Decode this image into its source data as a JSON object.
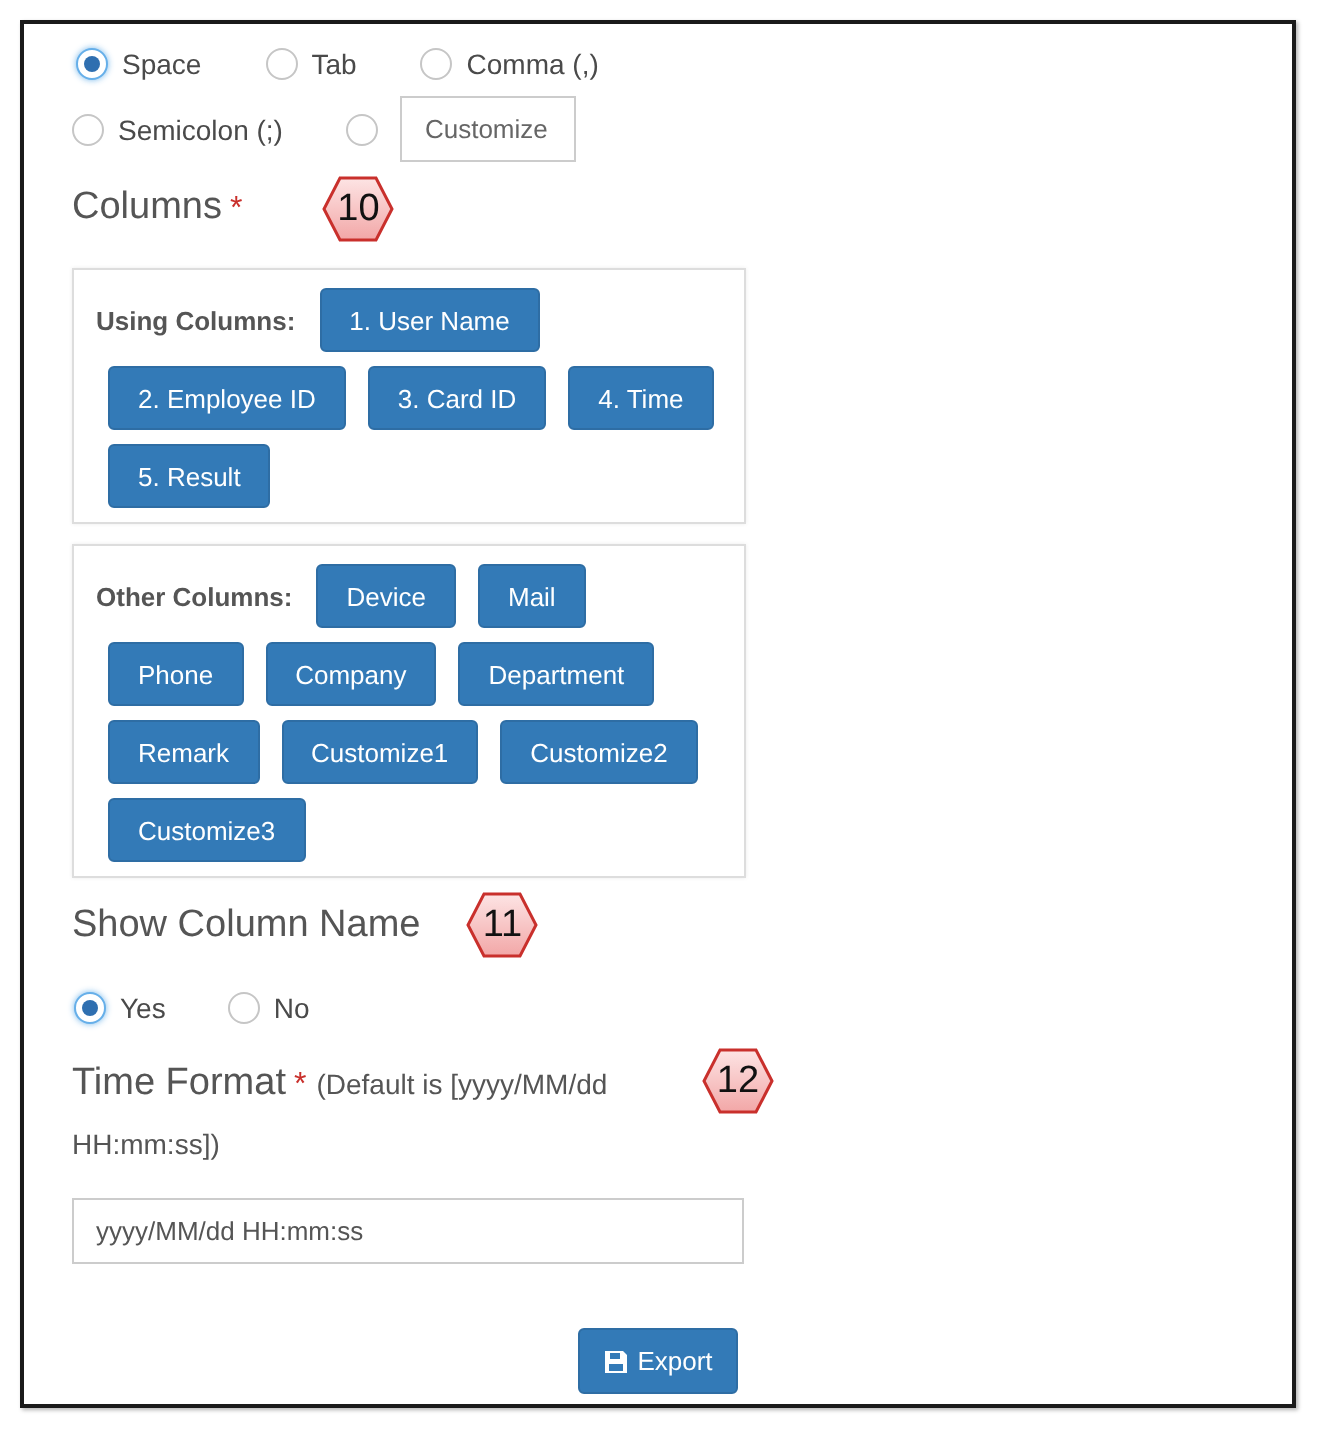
{
  "delimiter": {
    "rows": [
      {
        "options": [
          {
            "kind": "text",
            "label": "Space",
            "selected": true
          },
          {
            "kind": "text",
            "label": "Tab",
            "selected": false
          },
          {
            "kind": "text",
            "label": "Comma (,)",
            "selected": false
          }
        ]
      },
      {
        "options": [
          {
            "kind": "text",
            "label": "Semicolon (;)",
            "selected": false
          },
          {
            "kind": "field",
            "placeholder": "Customize",
            "selected": false
          }
        ]
      }
    ]
  },
  "columns": {
    "heading": "Columns",
    "required_mark": "*",
    "callout": "10",
    "groups": [
      {
        "label": "Using Columns:",
        "items": [
          "1. User Name",
          "2. Employee ID",
          "3. Card ID",
          "4. Time",
          "5. Result"
        ]
      },
      {
        "label": "Other Columns:",
        "items": [
          "Device",
          "Mail",
          "Phone",
          "Company",
          "Department",
          "Remark",
          "Customize1",
          "Customize2",
          "Customize3"
        ]
      }
    ]
  },
  "show_column_name": {
    "heading": "Show Column Name",
    "callout": "11",
    "options": [
      {
        "kind": "text",
        "label": "Yes",
        "selected": true
      },
      {
        "kind": "text",
        "label": "No",
        "selected": false
      }
    ]
  },
  "time_format": {
    "heading": "Time Format",
    "required_mark": "*",
    "hint": "(Default is [yyyy/MM/dd HH:mm:ss])",
    "callout": "12",
    "value": "yyyy/MM/dd HH:mm:ss"
  },
  "export_button": {
    "label": "Export"
  }
}
